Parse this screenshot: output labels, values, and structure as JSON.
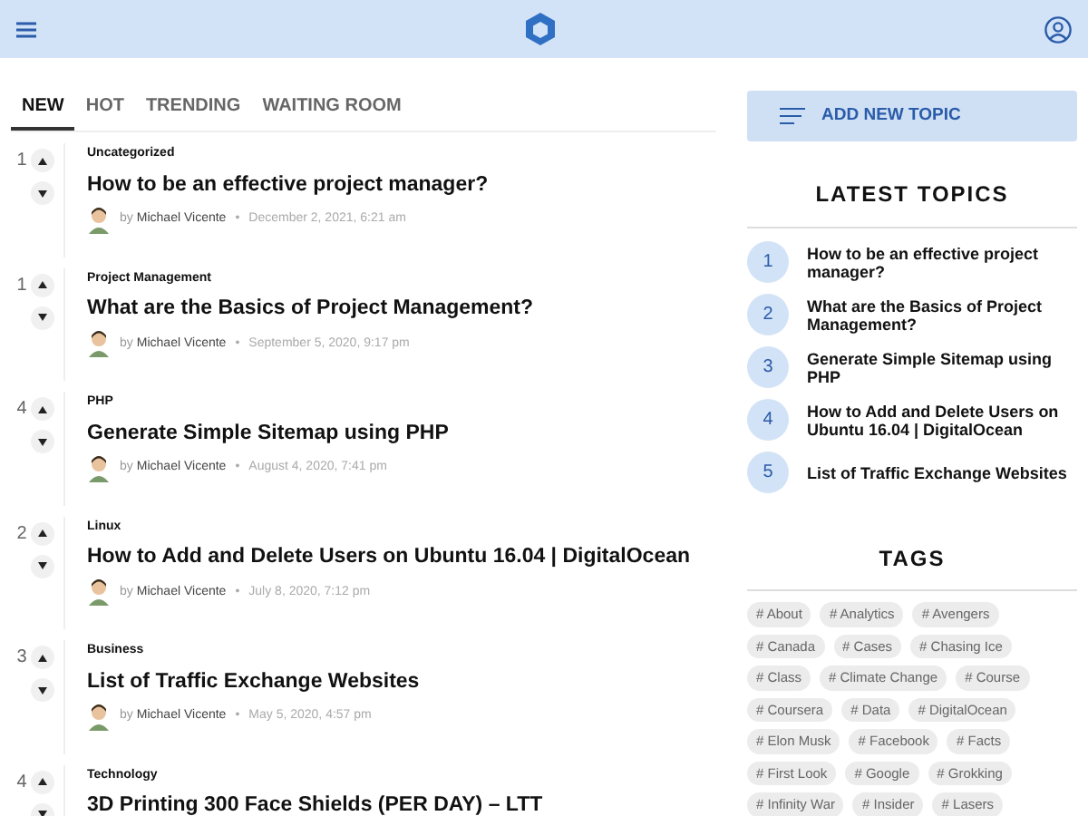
{
  "tabs": [
    {
      "label": "NEW",
      "selected": true
    },
    {
      "label": "HOT",
      "selected": false
    },
    {
      "label": "TRENDING",
      "selected": false
    },
    {
      "label": "WAITING ROOM",
      "selected": false
    }
  ],
  "posts": [
    {
      "votes": "1",
      "category": "Uncategorized",
      "title": "How to be an effective project manager?",
      "by": "by",
      "author": "Michael Vicente",
      "separator": "•",
      "date": "December 2, 2021, 6:21 am"
    },
    {
      "votes": "1",
      "category": "Project Management",
      "title": "What are the Basics of Project Management?",
      "by": "by",
      "author": "Michael Vicente",
      "separator": "•",
      "date": "September 5, 2020, 9:17 pm"
    },
    {
      "votes": "4",
      "category": "PHP",
      "title": "Generate Simple Sitemap using PHP",
      "by": "by",
      "author": "Michael Vicente",
      "separator": "•",
      "date": "August 4, 2020, 7:41 pm"
    },
    {
      "votes": "2",
      "category": "Linux",
      "title": "How to Add and Delete Users on Ubuntu 16.04 | DigitalOcean",
      "by": "by",
      "author": "Michael Vicente",
      "separator": "•",
      "date": "July 8, 2020, 7:12 pm"
    },
    {
      "votes": "3",
      "category": "Business",
      "title": "List of Traffic Exchange Websites",
      "by": "by",
      "author": "Michael Vicente",
      "separator": "•",
      "date": "May 5, 2020, 4:57 pm"
    },
    {
      "votes": "4",
      "category": "Technology",
      "title": "3D Printing 300 Face Shields (PER DAY) – LTT"
    }
  ],
  "add_topic": "ADD NEW TOPIC",
  "latest": {
    "title": "LATEST TOPICS",
    "items": [
      {
        "number": "1",
        "title": "How to be an effective project manager?"
      },
      {
        "number": "2",
        "title": "What are the Basics of Project Management?"
      },
      {
        "number": "3",
        "title": "Generate Simple Sitemap using PHP"
      },
      {
        "number": "4",
        "title": "How to Add and Delete Users on Ubuntu 16.04 | DigitalOcean"
      },
      {
        "number": "5",
        "title": "List of Traffic Exchange Websites"
      }
    ]
  },
  "tags": {
    "title": "TAGS",
    "items": [
      "# About",
      "# Analytics",
      "# Avengers",
      "# Canada",
      "# Cases",
      "# Chasing Ice",
      "# Class",
      "# Climate Change",
      "# Course",
      "# Coursera",
      "# Data",
      "# DigitalOcean",
      "# Elon Musk",
      "# Facebook",
      "# Facts",
      "# First Look",
      "# Google",
      "# Grokking",
      "# Infinity War",
      "# Insider",
      "# Lasers"
    ]
  }
}
